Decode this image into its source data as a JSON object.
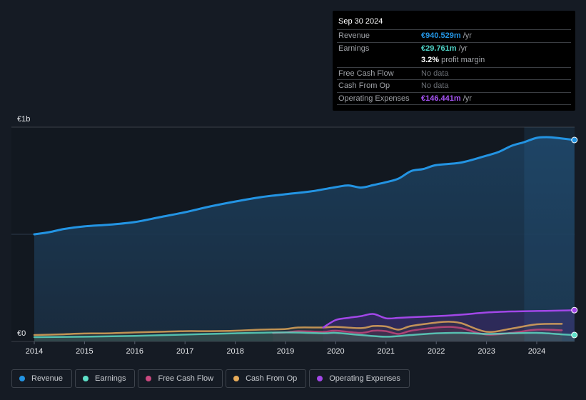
{
  "tooltip": {
    "date": "Sep 30 2024",
    "rows": [
      {
        "label": "Revenue",
        "value": "€940.529m",
        "unit": " /yr",
        "color": "#2394e3"
      },
      {
        "label": "Earnings",
        "value": "€29.761m",
        "unit": " /yr",
        "color": "#4fd1c5"
      },
      {
        "label": "",
        "value": "3.2%",
        "unit": " profit margin",
        "color": "#ffffff"
      },
      {
        "label": "Free Cash Flow",
        "value": "No data",
        "unit": "",
        "color": "#6b6f75"
      },
      {
        "label": "Cash From Op",
        "value": "No data",
        "unit": "",
        "color": "#6b6f75"
      },
      {
        "label": "Operating Expenses",
        "value": "€146.441m",
        "unit": " /yr",
        "color": "#a855f7"
      }
    ]
  },
  "legend": [
    {
      "label": "Revenue",
      "color": "#2394e3"
    },
    {
      "label": "Earnings",
      "color": "#5ee0c8"
    },
    {
      "label": "Free Cash Flow",
      "color": "#c9487e"
    },
    {
      "label": "Cash From Op",
      "color": "#e8ac5a"
    },
    {
      "label": "Operating Expenses",
      "color": "#a247e8"
    }
  ],
  "chart_data": {
    "type": "line",
    "title": "",
    "xlabel": "",
    "ylabel": "",
    "y_tick_labels": [
      "€0",
      "€1b"
    ],
    "x_tick_labels": [
      "2014",
      "2015",
      "2016",
      "2017",
      "2018",
      "2019",
      "2020",
      "2021",
      "2022",
      "2023",
      "2024"
    ],
    "xlim": [
      2014,
      2024.75
    ],
    "ylim": [
      0,
      1000
    ],
    "units": "€m",
    "grid": true,
    "forecast_shade_from": 2023.75,
    "series": [
      {
        "name": "Revenue",
        "color": "#2394e3",
        "fill": true,
        "x": [
          2014,
          2014.3,
          2014.6,
          2015,
          2015.5,
          2016,
          2016.5,
          2017,
          2017.5,
          2018,
          2018.5,
          2019,
          2019.5,
          2020,
          2020.25,
          2020.5,
          2020.75,
          2021,
          2021.25,
          2021.5,
          2021.75,
          2022,
          2022.5,
          2023,
          2023.25,
          2023.5,
          2023.75,
          2024,
          2024.25,
          2024.5,
          2024.75
        ],
        "y": [
          500,
          510,
          525,
          537,
          545,
          557,
          580,
          603,
          630,
          653,
          673,
          687,
          700,
          720,
          728,
          718,
          730,
          743,
          760,
          795,
          805,
          823,
          835,
          867,
          885,
          913,
          930,
          950,
          953,
          947,
          940
        ]
      },
      {
        "name": "Earnings",
        "color": "#5ee0c8",
        "fill": true,
        "x": [
          2014,
          2015,
          2016,
          2017,
          2018,
          2019,
          2019.75,
          2020,
          2020.5,
          2021,
          2021.5,
          2022,
          2022.5,
          2023,
          2023.5,
          2024,
          2024.5,
          2024.75
        ],
        "y": [
          20,
          22,
          26,
          32,
          38,
          42,
          38,
          40,
          30,
          22,
          30,
          38,
          40,
          35,
          38,
          40,
          33,
          30
        ]
      },
      {
        "name": "Free Cash Flow",
        "color": "#c9487e",
        "fill": true,
        "x": [
          2018.75,
          2019,
          2019.25,
          2019.75,
          2020,
          2020.5,
          2020.75,
          2021,
          2021.25,
          2021.5,
          2022,
          2022.25,
          2022.5,
          2023,
          2023.5,
          2024,
          2024.5
        ],
        "y": [
          40,
          42,
          48,
          45,
          50,
          40,
          50,
          48,
          35,
          50,
          65,
          68,
          62,
          32,
          40,
          55,
          52
        ]
      },
      {
        "name": "Cash From Op",
        "color": "#e8ac5a",
        "fill": true,
        "x": [
          2014,
          2014.5,
          2015,
          2015.5,
          2016,
          2016.5,
          2017,
          2017.5,
          2018,
          2018.5,
          2019,
          2019.25,
          2019.75,
          2020,
          2020.5,
          2020.75,
          2021,
          2021.25,
          2021.5,
          2022,
          2022.25,
          2022.5,
          2023,
          2023.5,
          2024,
          2024.5
        ],
        "y": [
          30,
          33,
          37,
          38,
          42,
          45,
          48,
          48,
          50,
          55,
          58,
          65,
          65,
          68,
          62,
          72,
          70,
          55,
          72,
          88,
          92,
          85,
          45,
          60,
          80,
          82
        ]
      },
      {
        "name": "Operating Expenses",
        "color": "#a247e8",
        "fill": true,
        "x": [
          2019.75,
          2020,
          2020.25,
          2020.5,
          2020.75,
          2021,
          2021.25,
          2021.5,
          2022,
          2022.5,
          2023,
          2023.5,
          2024,
          2024.5,
          2024.75
        ],
        "y": [
          65,
          100,
          110,
          118,
          128,
          108,
          110,
          113,
          118,
          125,
          135,
          140,
          142,
          144,
          146
        ]
      }
    ]
  }
}
